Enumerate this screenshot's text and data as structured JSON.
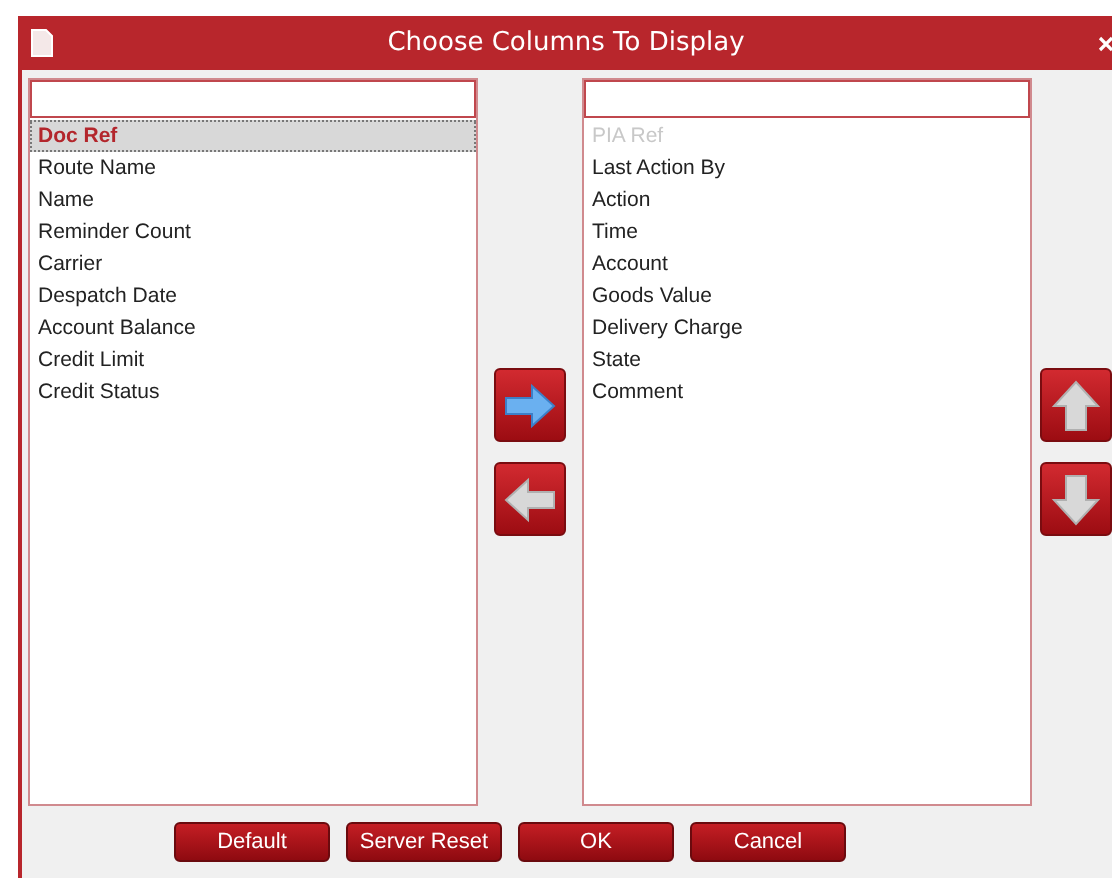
{
  "window": {
    "title": "Choose Columns To Display"
  },
  "available": {
    "items": [
      {
        "label": "Doc Ref",
        "selected": true,
        "disabled": false
      },
      {
        "label": "Route Name",
        "selected": false,
        "disabled": false
      },
      {
        "label": "Name",
        "selected": false,
        "disabled": false
      },
      {
        "label": "Reminder Count",
        "selected": false,
        "disabled": false
      },
      {
        "label": "Carrier",
        "selected": false,
        "disabled": false
      },
      {
        "label": "Despatch Date",
        "selected": false,
        "disabled": false
      },
      {
        "label": "Account Balance",
        "selected": false,
        "disabled": false
      },
      {
        "label": "Credit Limit",
        "selected": false,
        "disabled": false
      },
      {
        "label": "Credit Status",
        "selected": false,
        "disabled": false
      }
    ]
  },
  "displayed": {
    "items": [
      {
        "label": "PIA Ref",
        "selected": false,
        "disabled": true
      },
      {
        "label": "Last Action By",
        "selected": false,
        "disabled": false
      },
      {
        "label": "Action",
        "selected": false,
        "disabled": false
      },
      {
        "label": "Time",
        "selected": false,
        "disabled": false
      },
      {
        "label": "Account",
        "selected": false,
        "disabled": false
      },
      {
        "label": "Goods Value",
        "selected": false,
        "disabled": false
      },
      {
        "label": "Delivery Charge",
        "selected": false,
        "disabled": false
      },
      {
        "label": "State",
        "selected": false,
        "disabled": false
      },
      {
        "label": "Comment",
        "selected": false,
        "disabled": false
      }
    ]
  },
  "buttons": [
    "Default",
    "Server Reset",
    "OK",
    "Cancel"
  ]
}
